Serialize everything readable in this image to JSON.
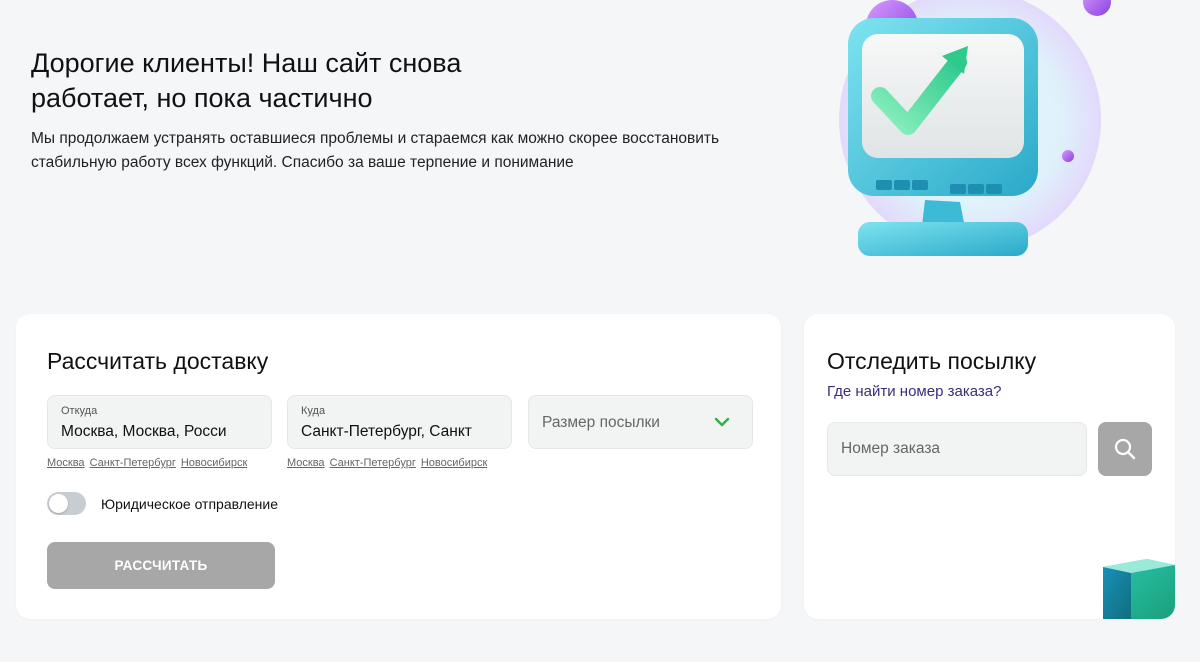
{
  "hero": {
    "title": "Дорогие клиенты! Наш сайт снова работает, но пока частично",
    "text": "Мы продолжаем устранять оставшиеся проблемы и стараемся как можно скорее восстановить стабильную работу всех функций. Спасибо за ваше терпение и понимание"
  },
  "calc": {
    "title": "Рассчитать доставку",
    "from": {
      "label": "Откуда",
      "value": "Москва, Москва, Росси",
      "quick_links": [
        "Москва",
        "Санкт-Петербург",
        "Новосибирск"
      ]
    },
    "to": {
      "label": "Куда",
      "value": "Санкт-Петербург, Санкт",
      "quick_links": [
        "Москва",
        "Санкт-Петербург",
        "Новосибирск"
      ]
    },
    "size": {
      "placeholder": "Размер посылки"
    },
    "legal_toggle": {
      "label": "Юридическое отправление",
      "checked": false
    },
    "submit_label": "РАССЧИТАТЬ"
  },
  "track": {
    "title": "Отследить посылку",
    "help_link": "Где найти номер заказа?",
    "input_placeholder": "Номер заказа"
  },
  "colors": {
    "background": "#f5f6f8",
    "accent_green": "#2fb344",
    "link_purple": "#3a2d7a",
    "button_disabled": "#a7a7a7"
  },
  "icons": {
    "chevron": "chevron-down-icon",
    "search": "search-icon",
    "illustration": "monitor-checkmark-illustration"
  }
}
